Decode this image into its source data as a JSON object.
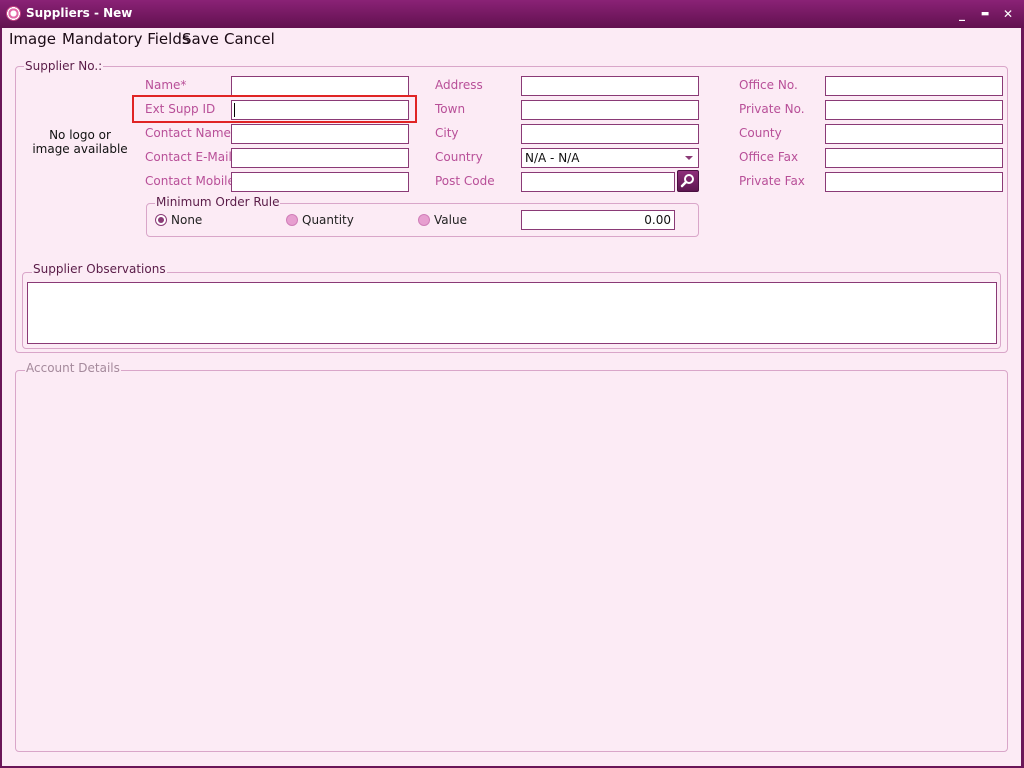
{
  "window": {
    "title": "Suppliers - New",
    "minimize": "_",
    "maximize": "▬",
    "close": "✕"
  },
  "menu": {
    "image": "Image",
    "mandatory": "Mandatory Fields",
    "save": "Save",
    "cancel": "Cancel"
  },
  "supplier_group": {
    "legend": "Supplier No.:"
  },
  "logo": {
    "line1": "No logo or",
    "line2": "image available"
  },
  "fields": {
    "name": {
      "label": "Name*",
      "value": ""
    },
    "ext_supp_id": {
      "label": "Ext Supp ID",
      "value": ""
    },
    "contact_name": {
      "label": "Contact Name",
      "value": ""
    },
    "contact_email": {
      "label": "Contact E-Mail*",
      "value": ""
    },
    "contact_mobile": {
      "label": "Contact Mobile",
      "value": ""
    },
    "address": {
      "label": "Address",
      "value": ""
    },
    "town": {
      "label": "Town",
      "value": ""
    },
    "city": {
      "label": "City",
      "value": ""
    },
    "country": {
      "label": "Country",
      "value": "N/A - N/A"
    },
    "post_code": {
      "label": "Post Code",
      "value": ""
    },
    "office_no": {
      "label": "Office No.",
      "value": ""
    },
    "private_no": {
      "label": "Private No.",
      "value": ""
    },
    "county": {
      "label": "County",
      "value": ""
    },
    "office_fax": {
      "label": "Office Fax",
      "value": ""
    },
    "private_fax": {
      "label": "Private Fax",
      "value": ""
    }
  },
  "min_order": {
    "legend": "Minimum Order Rule",
    "none": "None",
    "quantity": "Quantity",
    "value": "Value",
    "amount": "0.00",
    "selected": "None"
  },
  "observations": {
    "legend": "Supplier Observations",
    "value": ""
  },
  "account": {
    "legend": "Account Details"
  },
  "icons": {
    "app": "app-logo-icon",
    "search": "search-icon",
    "dropdown": "chevron-down-icon"
  },
  "colors": {
    "title_bar": "#6b1658",
    "background": "#fcebf5",
    "label": "#b84f98",
    "highlight": "#e02424"
  }
}
